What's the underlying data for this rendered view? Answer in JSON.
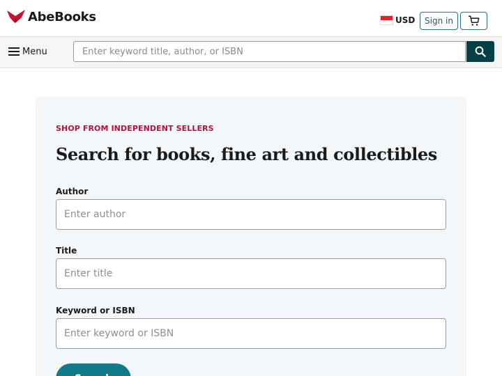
{
  "header": {
    "logo_text": "AbeBooks",
    "currency": "USD",
    "sign_in_label": "Sign in"
  },
  "nav": {
    "menu_label": "Menu",
    "search_placeholder": "Enter keyword title, author, or ISBN"
  },
  "search_card": {
    "eyebrow": "SHOP FROM INDEPENDENT SELLERS",
    "heading": "Search for books, fine art and collectibles",
    "fields": [
      {
        "label": "Author",
        "placeholder": "Enter author"
      },
      {
        "label": "Title",
        "placeholder": "Enter title"
      },
      {
        "label": "Keyword or ISBN",
        "placeholder": "Enter keyword or ISBN"
      }
    ],
    "submit_label": "Search"
  },
  "colors": {
    "brand_red": "#c8102e",
    "accent_teal": "#0e7a8a",
    "search_button": "#084047",
    "eyebrow": "#b3123e"
  },
  "icons": {
    "logo": "abebooks-bird-icon",
    "flag": "singapore-flag-icon",
    "cart": "cart-icon",
    "menu": "hamburger-icon",
    "search": "search-icon"
  }
}
